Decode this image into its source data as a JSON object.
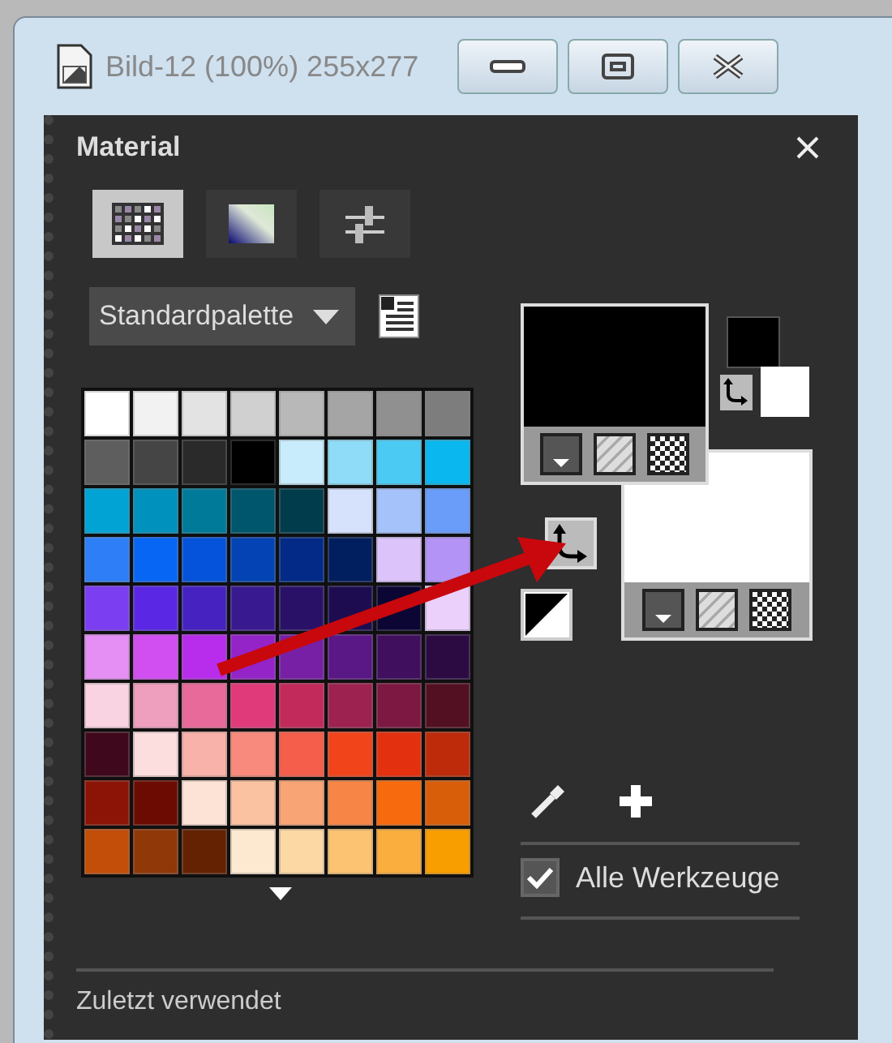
{
  "window": {
    "title": "Bild-12 (100%) 255x277"
  },
  "panel": {
    "title": "Material",
    "tabs": [
      {
        "kind": "swatches",
        "selected": true
      },
      {
        "kind": "gradient",
        "selected": false
      },
      {
        "kind": "sliders",
        "selected": false
      }
    ],
    "palette_dropdown": {
      "value": "Standardpalette"
    },
    "swatch_rows": [
      [
        {
          "color": "#ffffff"
        },
        {
          "color": "#f2f2f2"
        },
        {
          "color": "#e3e3e3"
        },
        {
          "color": "#d0d0d0"
        },
        {
          "color": "#b8b8b8"
        },
        {
          "color": "#a5a5a5"
        },
        {
          "color": "#909090"
        },
        {
          "color": "#7d7d7d"
        }
      ],
      [
        {
          "color": "#5e5e5e"
        },
        {
          "color": "#454545"
        },
        {
          "color": "#2a2a2a"
        },
        {
          "color": "#000000"
        },
        {
          "color": "#c8ecfb"
        },
        {
          "color": "#8fdcf8"
        },
        {
          "color": "#4bcaf4"
        },
        {
          "color": "#0ab8ef"
        }
      ],
      [
        {
          "color": "#00a3d4"
        },
        {
          "color": "#0091bd"
        },
        {
          "color": "#007a99"
        },
        {
          "color": "#00566c"
        },
        {
          "color": "#003c4c"
        },
        {
          "color": "#d6e2fc"
        },
        {
          "color": "#a6c2fb"
        },
        {
          "color": "#6a9cf9"
        }
      ],
      [
        {
          "color": "#2e7ef7"
        },
        {
          "color": "#0866f5"
        },
        {
          "color": "#0553db"
        },
        {
          "color": "#0343b3"
        },
        {
          "color": "#022a86"
        },
        {
          "color": "#011f5e"
        },
        {
          "color": "#dcc4fb"
        },
        {
          "color": "#b393f6"
        }
      ],
      [
        {
          "color": "#7b3ef1"
        },
        {
          "color": "#5a27e5"
        },
        {
          "color": "#4622c0"
        },
        {
          "color": "#39198f"
        },
        {
          "color": "#2a1168"
        },
        {
          "color": "#1d0d50"
        },
        {
          "color": "#0b0633"
        },
        {
          "color": "#ebd0fc"
        }
      ],
      [
        {
          "color": "#e58ff5"
        },
        {
          "color": "#d14ef1"
        },
        {
          "color": "#b82ceb"
        },
        {
          "color": "#9423c8"
        },
        {
          "color": "#7720a5"
        },
        {
          "color": "#5a1786"
        },
        {
          "color": "#40105f"
        },
        {
          "color": "#2c0b42"
        }
      ],
      [
        {
          "color": "#f9d3e2"
        },
        {
          "color": "#ee9fbe"
        },
        {
          "color": "#e86a9a"
        },
        {
          "color": "#e13a7a"
        },
        {
          "color": "#c32a5c"
        },
        {
          "color": "#9d2250"
        },
        {
          "color": "#7c1842"
        },
        {
          "color": "#521022"
        }
      ],
      [
        {
          "color": "#40081c"
        },
        {
          "color": "#fbdedd"
        },
        {
          "color": "#f9b2aa"
        },
        {
          "color": "#f78a7c"
        },
        {
          "color": "#f55e4b"
        },
        {
          "color": "#f2441b"
        },
        {
          "color": "#e3300f"
        },
        {
          "color": "#be2b0a"
        }
      ],
      [
        {
          "color": "#8c1406"
        },
        {
          "color": "#6b0b02"
        },
        {
          "color": "#fde3d6"
        },
        {
          "color": "#fbc2a1"
        },
        {
          "color": "#f9a474"
        },
        {
          "color": "#f78545"
        },
        {
          "color": "#f76a0e"
        },
        {
          "color": "#d95e0a"
        }
      ],
      [
        {
          "color": "#c24e0a"
        },
        {
          "color": "#913808"
        },
        {
          "color": "#642203"
        },
        {
          "color": "#fde9cf"
        },
        {
          "color": "#fcd8a5"
        },
        {
          "color": "#fbc372"
        },
        {
          "color": "#f9ae3e"
        },
        {
          "color": "#f99e00"
        }
      ]
    ],
    "foreground": {
      "color": "#000000"
    },
    "background": {
      "color": "#ffffff"
    },
    "all_tools": {
      "label": "Alle Werkzeuge",
      "checked": true
    },
    "recent_label": "Zuletzt verwendet"
  }
}
